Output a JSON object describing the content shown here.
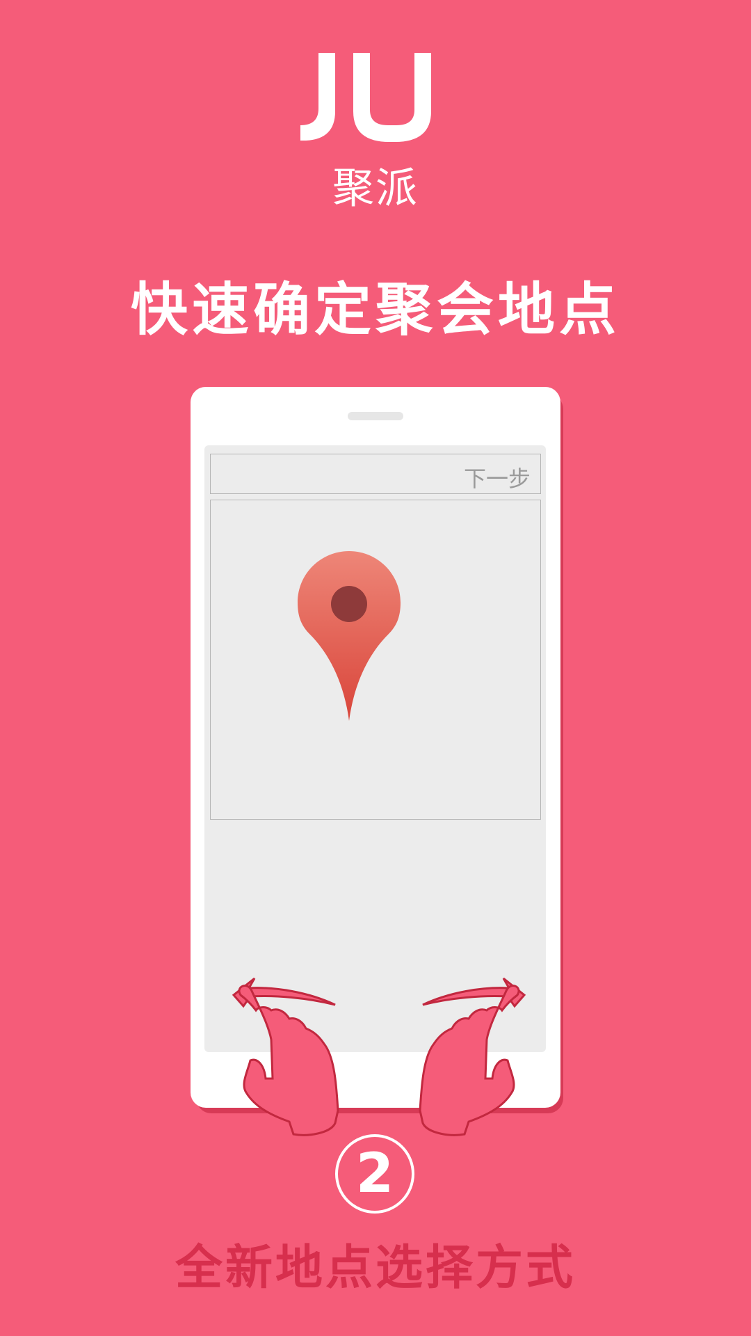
{
  "app": {
    "logo_text": "JU",
    "brand_name": "聚派"
  },
  "headline": "快速确定聚会地点",
  "phone_screen": {
    "next_label": "下一步",
    "map_pin_icon": "location-pin-icon"
  },
  "step": {
    "number": "2",
    "caption": "全新地点选择方式"
  },
  "colors": {
    "background": "#f55c79",
    "accent_dark": "#d72f4d",
    "pin_top": "#ee8678",
    "pin_bottom": "#d9453a",
    "pin_dot": "#8e3a3a"
  }
}
